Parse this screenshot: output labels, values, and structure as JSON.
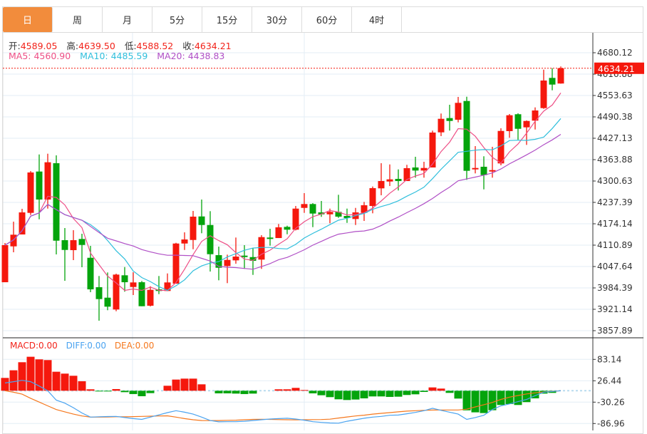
{
  "tabs": [
    {
      "label": "日",
      "active": true
    },
    {
      "label": "周",
      "active": false
    },
    {
      "label": "月",
      "active": false
    },
    {
      "label": "5分",
      "active": false
    },
    {
      "label": "15分",
      "active": false
    },
    {
      "label": "30分",
      "active": false
    },
    {
      "label": "60分",
      "active": false
    },
    {
      "label": "4时",
      "active": false
    }
  ],
  "ohlc_info": {
    "open_label": "开:",
    "open": "4589.05",
    "high_label": "高:",
    "high": "4639.50",
    "low_label": "低:",
    "low": "4588.52",
    "close_label": "收:",
    "close": "4634.21"
  },
  "ma_info": {
    "ma5": "MA5: 4560.90",
    "ma10": "MA10: 4485.59",
    "ma20": "MA20: 4438.83"
  },
  "macd_info": {
    "macd": "MACD:0.00",
    "diff": "DIFF:0.00",
    "dea": "DEA:0.00"
  },
  "colors": {
    "up": "#f5180d",
    "down": "#04a40c",
    "ma5": "#ee4f86",
    "ma10": "#30bfdc",
    "ma20": "#b04fc6",
    "diff": "#4aa3f0",
    "dea": "#f5781e",
    "accent": "#f28c3c"
  },
  "chart_data": [
    {
      "type": "candlestick",
      "price_ticks": [
        "4680.12",
        "4616.88",
        "4553.63",
        "4490.38",
        "4427.13",
        "4363.88",
        "4300.63",
        "4237.39",
        "4174.14",
        "4110.89",
        "4047.64",
        "3984.39",
        "3921.14",
        "3857.89"
      ],
      "ylim": [
        3857.89,
        4680.12
      ],
      "last_price": "4634.21",
      "ma_periods": [
        5,
        10,
        20
      ],
      "candles": [
        [
          4001.2,
          4110.9,
          4117.2,
          4001.2
        ],
        [
          4107.3,
          4141.8,
          4180.4,
          4089.8
        ],
        [
          4142.5,
          4207.8,
          4218.4,
          4142.5
        ],
        [
          4206.4,
          4325.9,
          4330.1,
          4200.0
        ],
        [
          4328.7,
          4245.8,
          4379.2,
          4187.4
        ],
        [
          4245.8,
          4356.1,
          4381.4,
          4219.0
        ],
        [
          4353.3,
          4124.1,
          4376.5,
          4083.5
        ],
        [
          4125.6,
          4096.7,
          4161.5,
          4005.4
        ],
        [
          4096.1,
          4125.6,
          4155.1,
          4066.6
        ],
        [
          4129.2,
          4111.5,
          4144.6,
          4045.5
        ],
        [
          4073.5,
          3980.1,
          4108.8,
          3971.7
        ],
        [
          3986.5,
          3951.3,
          4019.6,
          3887.4
        ],
        [
          3955.5,
          3928.9,
          4030.1,
          3918.4
        ],
        [
          3920.5,
          4023.8,
          4026.5,
          3915.4
        ],
        [
          4021.7,
          4001.2,
          4046.1,
          3973.2
        ],
        [
          3987.1,
          4000.6,
          4030.7,
          3963.3
        ],
        [
          4001.2,
          3930.2,
          4004.8,
          3930.2
        ],
        [
          3931.7,
          3978.7,
          3989.2,
          3929.5
        ],
        [
          3980.1,
          3975.3,
          4019.6,
          3966.0
        ],
        [
          3975.3,
          4000.6,
          4027.2,
          3975.3
        ],
        [
          3997.0,
          4115.7,
          4117.8,
          3997.0
        ],
        [
          4115.7,
          4127.7,
          4148.8,
          4096.7
        ],
        [
          4126.2,
          4195.2,
          4212.1,
          4098.8
        ],
        [
          4195.8,
          4170.5,
          4245.8,
          4146.1
        ],
        [
          4170.5,
          4084.1,
          4211.4,
          4032.8
        ],
        [
          4081.3,
          4044.0,
          4106.6,
          4006.9
        ],
        [
          4049.1,
          4067.2,
          4082.8,
          3998.5
        ],
        [
          4065.9,
          4077.1,
          4133.4,
          4056.0
        ],
        [
          4079.9,
          4075.6,
          4110.9,
          4040.7
        ],
        [
          4075.6,
          4064.5,
          4101.8,
          4022.9
        ],
        [
          4068.1,
          4134.7,
          4140.4,
          4040.7
        ],
        [
          4133.4,
          4129.2,
          4159.3,
          4109.4
        ],
        [
          4131.9,
          4163.6,
          4173.5,
          4131.9
        ],
        [
          4165.0,
          4156.6,
          4168.4,
          4143.1
        ],
        [
          4156.6,
          4219.0,
          4226.8,
          4154.5
        ],
        [
          4221.1,
          4232.5,
          4264.8,
          4206.4
        ],
        [
          4232.5,
          4204.3,
          4235.2,
          4164.2
        ],
        [
          4207.8,
          4202.1,
          4241.6,
          4194.6
        ],
        [
          4202.1,
          4209.3,
          4219.0,
          4175.6
        ],
        [
          4209.3,
          4195.2,
          4259.9,
          4191.6
        ],
        [
          4197.3,
          4191.0,
          4219.0,
          4176.8
        ],
        [
          4188.2,
          4207.8,
          4221.1,
          4170.5
        ],
        [
          4206.4,
          4228.9,
          4238.8,
          4182.5
        ],
        [
          4226.8,
          4279.5,
          4284.4,
          4205.1
        ],
        [
          4278.9,
          4300.6,
          4353.3,
          4258.4
        ],
        [
          4299.1,
          4305.5,
          4349.7,
          4285.8
        ],
        [
          4306.9,
          4300.6,
          4335.0,
          4272.6
        ],
        [
          4300.6,
          4338.6,
          4348.5,
          4300.6
        ],
        [
          4340.7,
          4331.6,
          4372.3,
          4310.5
        ],
        [
          4331.6,
          4339.2,
          4357.5,
          4310.5
        ],
        [
          4340.7,
          4444.0,
          4449.7,
          4340.7
        ],
        [
          4444.6,
          4484.7,
          4500.3,
          4433.4
        ],
        [
          4486.8,
          4478.3,
          4526.2,
          4449.7
        ],
        [
          4481.9,
          4531.9,
          4549.4,
          4474.1
        ],
        [
          4537.4,
          4330.8,
          4550.0,
          4304.2
        ],
        [
          4335.0,
          4339.2,
          4403.9,
          4323.2
        ],
        [
          4342.8,
          4318.1,
          4373.8,
          4275.9
        ],
        [
          4328.7,
          4332.9,
          4401.8,
          4310.5
        ],
        [
          4352.7,
          4448.8,
          4456.6,
          4347.0
        ],
        [
          4448.2,
          4495.2,
          4498.8,
          4428.6
        ],
        [
          4498.2,
          4455.1,
          4500.9,
          4422.9
        ],
        [
          4459.4,
          4478.3,
          4479.8,
          4407.5
        ],
        [
          4479.2,
          4509.3,
          4518.4,
          4453.0
        ],
        [
          4516.3,
          4597.9,
          4630.1,
          4514.2
        ],
        [
          4605.7,
          4585.9,
          4634.4,
          4569.0
        ],
        [
          4589.05,
          4634.21,
          4639.5,
          4588.52
        ]
      ]
    },
    {
      "type": "bar+line",
      "name": "MACD",
      "macd_ticks": [
        "83.14",
        "26.44",
        "-30.26",
        "-86.96"
      ],
      "ylim": [
        -86.96,
        83.14
      ],
      "macd_hist": [
        34.0,
        54.2,
        75.6,
        90.1,
        83.2,
        81.3,
        50.4,
        45.4,
        39.7,
        25.2,
        3.8,
        -1.9,
        -1.9,
        4.4,
        -3.8,
        -8.8,
        -14.5,
        -6.3,
        -0.3,
        13.2,
        29.6,
        32.1,
        32.1,
        17.0,
        0.3,
        -6.9,
        -6.9,
        -7.6,
        -8.8,
        -7.6,
        -0.3,
        0.2,
        3.8,
        3.8,
        7.6,
        1.9,
        -6.9,
        -12.0,
        -17.0,
        -22.7,
        -24.6,
        -23.3,
        -20.2,
        -15.1,
        -15.1,
        -16.4,
        -15.8,
        -11.3,
        -9.5,
        -3.2,
        8.8,
        5.7,
        -5.7,
        -20.8,
        -52.0,
        -57.3,
        -59.2,
        -51.7,
        -37.8,
        -35.3,
        -37.8,
        -30.2,
        -20.2,
        -7.6,
        -5.7,
        0
      ],
      "diff": [
        20.5,
        24,
        27.5,
        24,
        12.5,
        0,
        -25,
        -33,
        -45,
        -59,
        -70,
        -69,
        -68.5,
        -68,
        -71,
        -74,
        -76,
        -70,
        -64,
        -58,
        -53,
        -57,
        -62,
        -70,
        -79,
        -82.5,
        -82,
        -82,
        -81,
        -79,
        -77,
        -75,
        -74,
        -73,
        -75,
        -78,
        -82,
        -84,
        -85.5,
        -86,
        -81,
        -77,
        -73,
        -70,
        -68,
        -65,
        -64.5,
        -61,
        -57.5,
        -53,
        -46.6,
        -52,
        -57,
        -62,
        -76,
        -71,
        -65,
        -50,
        -40,
        -35,
        -29,
        -23,
        -13,
        -4,
        -2,
        0
      ],
      "dea": [
        0,
        -4,
        -9,
        -20,
        -30,
        -40,
        -50,
        -56,
        -62,
        -67,
        -70,
        -70,
        -69.5,
        -69,
        -69,
        -68.7,
        -68,
        -67.5,
        -67,
        -66.5,
        -70,
        -74,
        -77,
        -79,
        -79.3,
        -79,
        -78.5,
        -78,
        -77,
        -76,
        -75.6,
        -76,
        -76.5,
        -77,
        -77.3,
        -77,
        -76.5,
        -76.3,
        -75.5,
        -72.5,
        -69.5,
        -67,
        -64.8,
        -62,
        -60,
        -58,
        -56,
        -54,
        -53,
        -52,
        -51.2,
        -51,
        -51,
        -51,
        -49,
        -43,
        -37,
        -31,
        -23,
        -17,
        -12.7,
        -8.5,
        -5.5,
        -3.5,
        -1.5,
        0
      ]
    }
  ]
}
